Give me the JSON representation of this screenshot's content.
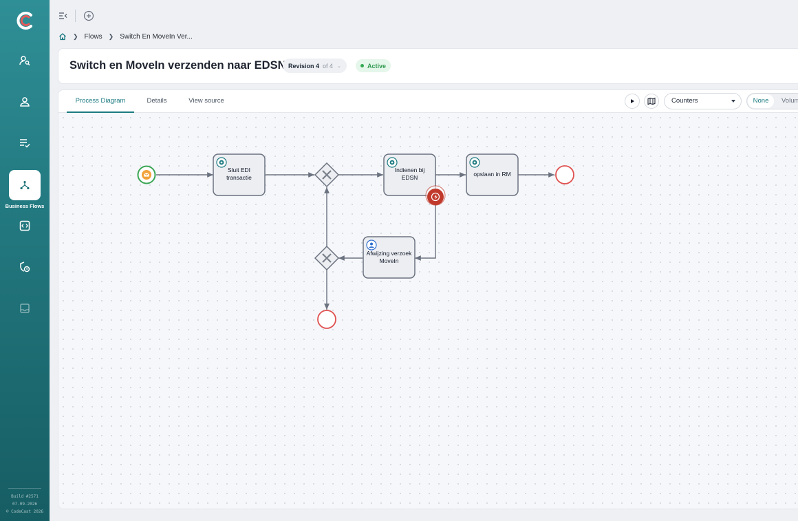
{
  "sidebar": {
    "active_label": "Business Flows",
    "build": "Build #2571",
    "date": "07-09-2026",
    "copyright": "© CodeCast 2026"
  },
  "breadcrumb": {
    "flows": "Flows",
    "current": "Switch En MoveIn Ver..."
  },
  "header": {
    "title": "Switch en MoveIn verzenden naar EDSN",
    "revision": "Revision 4",
    "revision_of": "of 4",
    "status": "Active"
  },
  "tabs": [
    {
      "label": "Process Diagram",
      "active": true
    },
    {
      "label": "Details",
      "active": false
    },
    {
      "label": "View source",
      "active": false
    }
  ],
  "toolbar": {
    "counters_select": "Counters",
    "seg_none": "None",
    "seg_volume": "Volume"
  },
  "diagram": {
    "task_sluit": "Sluit EDI transactie",
    "task_indienen": "Indienen bij EDSN",
    "task_opslaan": "opslaan in RM",
    "task_afwijzing": "Afwijzing verzoek MoveIn"
  },
  "colors": {
    "accent": "#1b7a80",
    "active_green": "#2e9a4f",
    "start_event": "#3aa655",
    "end_event": "#e05252",
    "error_event": "#c0392b"
  }
}
